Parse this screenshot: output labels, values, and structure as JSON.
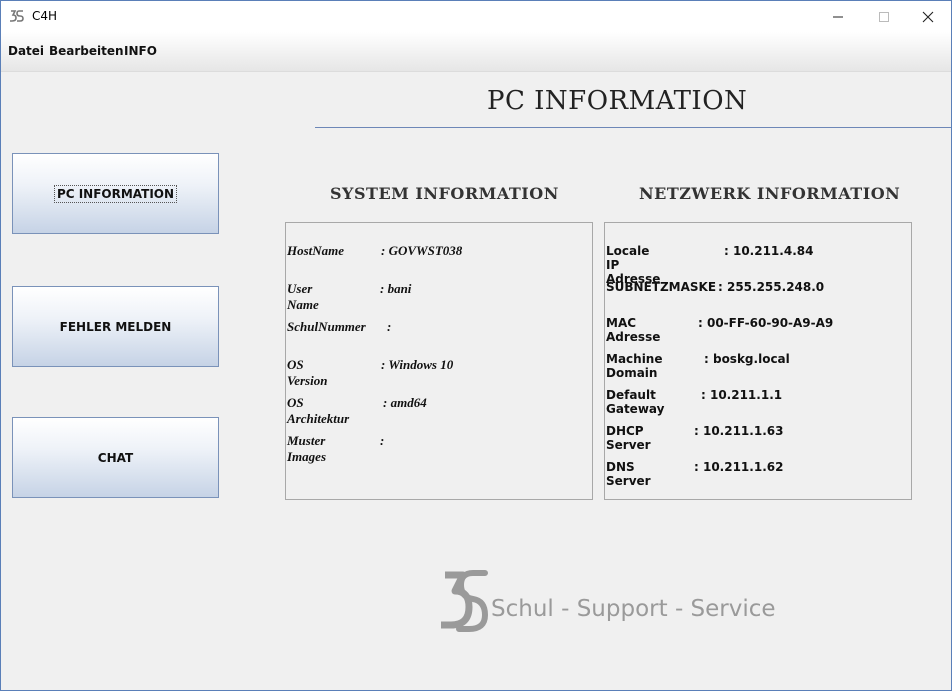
{
  "window": {
    "title": "C4H",
    "icon": "app-logo-icon",
    "controls": [
      "minimize-icon",
      "maximize-icon",
      "close-icon"
    ]
  },
  "menu": {
    "items": [
      "Datei",
      "Bearbeiten",
      "INFO"
    ]
  },
  "page": {
    "title": "PC INFORMATION"
  },
  "nav": {
    "pc_information": "PC INFORMATION",
    "fehler_melden": "FEHLER MELDEN",
    "chat": "CHAT"
  },
  "system": {
    "heading": "SYSTEM INFORMATION",
    "rows": [
      {
        "label": "HostName",
        "value": ": GOVWST038"
      },
      {
        "label": "User Name",
        "value": ": bani"
      },
      {
        "label": "SchulNummer",
        "value": ":"
      },
      {
        "label": "OS Version",
        "value": ": Windows 10"
      },
      {
        "label": "OS Architektur",
        "value": ": amd64"
      },
      {
        "label": "Muster Images",
        "value": ":"
      }
    ]
  },
  "network": {
    "heading": "NETZWERK INFORMATION",
    "rows": [
      {
        "label": "Locale IP Adresse",
        "value": ": 10.211.4.84"
      },
      {
        "label": "SUBNETZMASKE",
        "value": ": 255.255.248.0"
      },
      {
        "label": "MAC Adresse",
        "value": ": 00-FF-60-90-A9-A9"
      },
      {
        "label": "Machine Domain",
        "value": ": boskg.local"
      },
      {
        "label": "Default Gateway",
        "value": ": 10.211.1.1"
      },
      {
        "label": "DHCP Server",
        "value": ": 10.211.1.63"
      },
      {
        "label": "DNS Server",
        "value": ": 10.211.1.62"
      }
    ]
  },
  "branding": {
    "text": "Schul - Support - Service",
    "icon": "3s-logo-icon",
    "color": "#9a9a9a"
  },
  "colors": {
    "accent_border": "#7a92b9",
    "title_rule": "#6d87b7"
  }
}
